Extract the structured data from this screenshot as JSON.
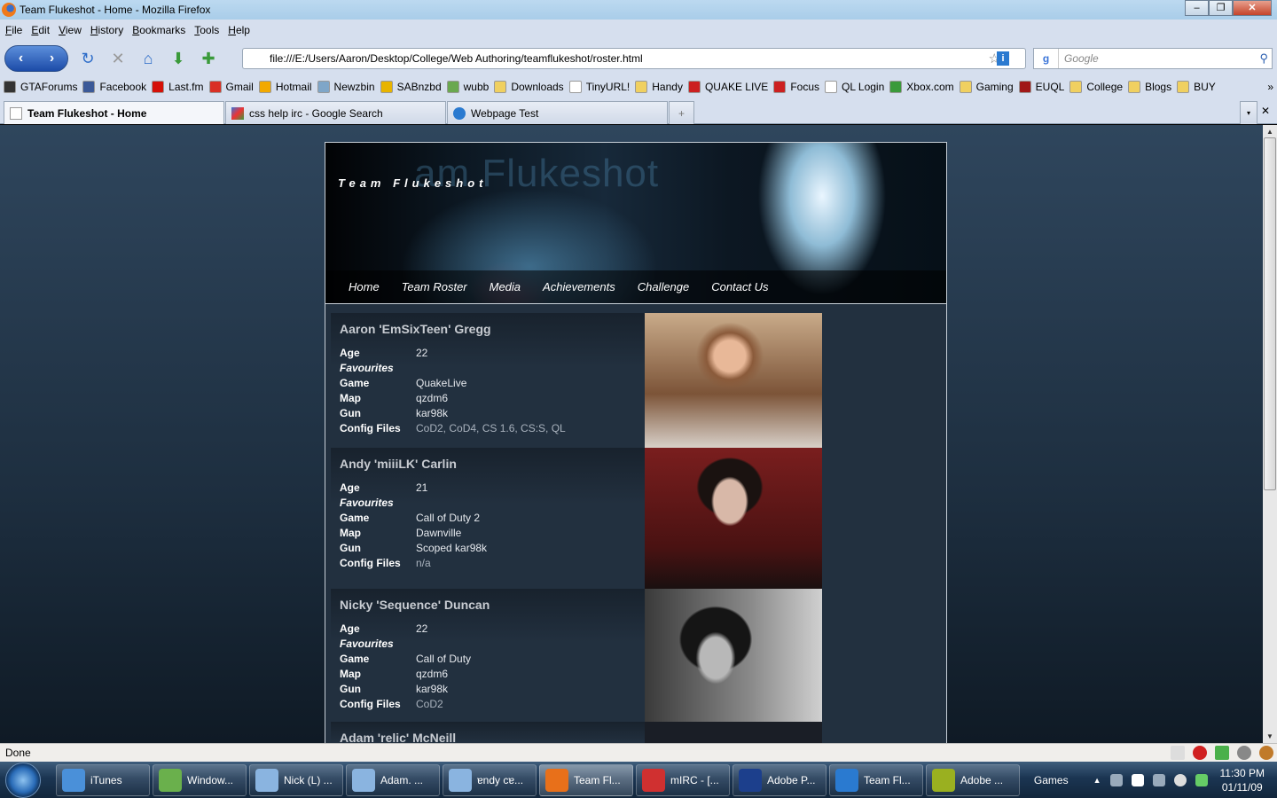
{
  "window": {
    "title": "Team Flukeshot - Home - Mozilla Firefox"
  },
  "menu": [
    "File",
    "Edit",
    "View",
    "History",
    "Bookmarks",
    "Tools",
    "Help"
  ],
  "url": "file:///E:/Users/Aaron/Desktop/College/Web Authoring/teamflukeshot/roster.html",
  "search_placeholder": "Google",
  "bookmarks": [
    {
      "label": "GTAForums",
      "color": "#333333"
    },
    {
      "label": "Facebook",
      "color": "#3b5998"
    },
    {
      "label": "Last.fm",
      "color": "#d51007"
    },
    {
      "label": "Gmail",
      "color": "#d93025"
    },
    {
      "label": "Hotmail",
      "color": "#f2a900"
    },
    {
      "label": "Newzbin",
      "color": "#7fa6c8"
    },
    {
      "label": "SABnzbd",
      "color": "#e8b400"
    },
    {
      "label": "wubb",
      "color": "#6aa84f"
    },
    {
      "label": "Downloads",
      "color": "#f0d060"
    },
    {
      "label": "TinyURL!",
      "color": "#ffffff"
    },
    {
      "label": "Handy",
      "color": "#f0d060"
    },
    {
      "label": "QUAKE LIVE",
      "color": "#cc2020"
    },
    {
      "label": "Focus",
      "color": "#cc2020"
    },
    {
      "label": "QL Login",
      "color": "#ffffff"
    },
    {
      "label": "Xbox.com",
      "color": "#3a9a3a"
    },
    {
      "label": "Gaming",
      "color": "#f0d060"
    },
    {
      "label": "EUQL",
      "color": "#a01818"
    },
    {
      "label": "College",
      "color": "#f0d060"
    },
    {
      "label": "Blogs",
      "color": "#f0d060"
    },
    {
      "label": "BUY",
      "color": "#f0d060"
    }
  ],
  "bookmarks_more": "»",
  "tabs": [
    {
      "label": "Team Flukeshot - Home"
    },
    {
      "label": "css help irc - Google Search"
    },
    {
      "label": "Webpage Test"
    }
  ],
  "site": {
    "logo": "Team Flukeshot",
    "ghost_logo": "am Flukeshot",
    "nav": [
      "Home",
      "Team Roster",
      "Media",
      "Achievements",
      "Challenge",
      "Contact Us"
    ],
    "labels": {
      "age": "Age",
      "favourites": "Favourites",
      "game": "Game",
      "map": "Map",
      "gun": "Gun",
      "config": "Config Files"
    },
    "members": [
      {
        "name": "Aaron 'EmSixTeen' Gregg",
        "age": "22",
        "game": "QuakeLive",
        "map": "qzdm6",
        "gun": "kar98k",
        "config": "CoD2, CoD4, CS 1.6, CS:S, QL"
      },
      {
        "name": "Andy 'miiiLK' Carlin",
        "age": "21",
        "game": "Call of Duty 2",
        "map": "Dawnville",
        "gun": "Scoped kar98k",
        "config": "n/a"
      },
      {
        "name": "Nicky 'Sequence' Duncan",
        "age": "22",
        "game": "Call of Duty",
        "map": "qzdm6",
        "gun": "kar98k",
        "config": "CoD2"
      },
      {
        "name": "Adam 'relic' McNeill"
      }
    ]
  },
  "status": "Done",
  "taskbar": {
    "items": [
      {
        "label": "iTunes",
        "color": "#4a90d9"
      },
      {
        "label": "Window...",
        "color": "#6ab04c"
      },
      {
        "label": "Nick (L) ...",
        "color": "#8ab4e0"
      },
      {
        "label": "Adam. ...",
        "color": "#8ab4e0"
      },
      {
        "label": "ɐndy cɐ...",
        "color": "#8ab4e0"
      },
      {
        "label": "Team Fl...",
        "color": "#e8701a"
      },
      {
        "label": "mIRC - [...",
        "color": "#d03030"
      },
      {
        "label": "Adobe P...",
        "color": "#1c3f8c"
      },
      {
        "label": "Team Fl...",
        "color": "#2a7ad0"
      },
      {
        "label": "Adobe ...",
        "color": "#9ab020"
      }
    ],
    "games": "Games",
    "time": "11:30 PM",
    "date": "01/11/09"
  }
}
